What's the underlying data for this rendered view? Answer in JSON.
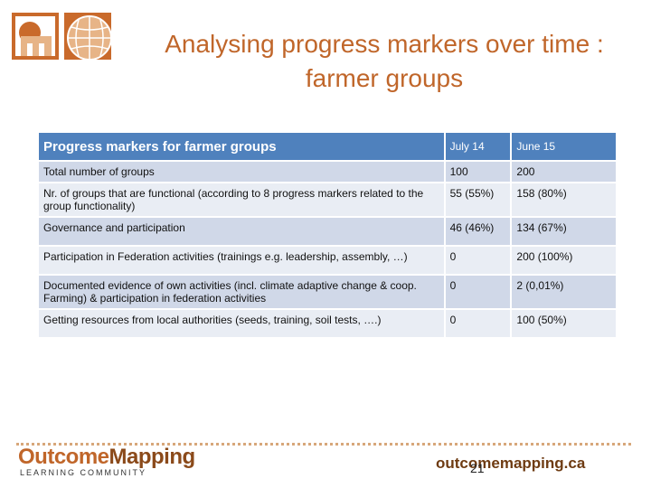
{
  "header": {
    "logo": "outcome-mapping-logo",
    "title_line1": "Analysing progress markers over time :",
    "title_line2": "farmer groups"
  },
  "table": {
    "headers": [
      "Progress markers for farmer groups",
      "July  14",
      "June 15"
    ],
    "rows": [
      [
        "Total number of groups",
        "100",
        "200"
      ],
      [
        "Nr. of groups that are functional (according to 8 progress markers related to the group functionality)",
        "55 (55%)",
        "158 (80%)"
      ],
      [
        "Governance and participation",
        "46 (46%)",
        "134 (67%)"
      ],
      [
        "Participation in Federation activities (trainings e.g. leadership, assembly, …)",
        "0",
        "200 (100%)"
      ],
      [
        "Documented evidence of own activities (incl. climate adaptive change & coop. Farming) & participation in federation activities",
        "0",
        "2 (0,01%)"
      ],
      [
        "Getting resources from local authorities (seeds, training, soil tests, ….)",
        "0",
        "100 (50%)"
      ]
    ]
  },
  "footer": {
    "brand_part1": "Outcome",
    "brand_part2": "Mapping",
    "subtitle": "LEARNING  COMMUNITY",
    "url": "outcomemapping.ca",
    "slide_number": "21"
  },
  "colors": {
    "title": "#c0662a",
    "header_bg": "#4f81bd",
    "row_odd": "#d0d8e8",
    "row_even": "#e9edf4"
  }
}
